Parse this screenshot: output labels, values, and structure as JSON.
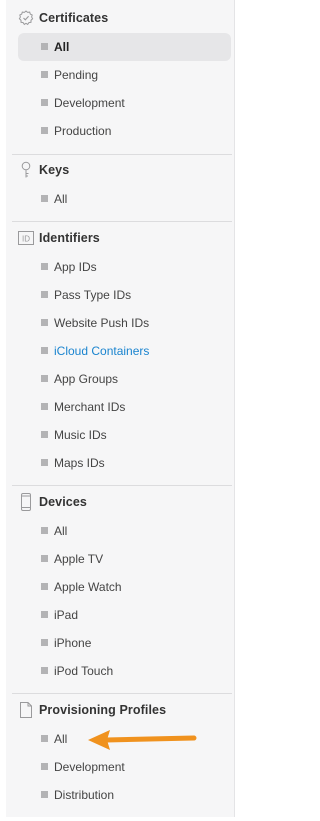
{
  "sections": [
    {
      "title": "Certificates",
      "icon": "certificate-badge-icon",
      "items": [
        {
          "label": "All",
          "active": true
        },
        {
          "label": "Pending"
        },
        {
          "label": "Development"
        },
        {
          "label": "Production"
        }
      ]
    },
    {
      "title": "Keys",
      "icon": "key-icon",
      "items": [
        {
          "label": "All"
        }
      ]
    },
    {
      "title": "Identifiers",
      "icon": "id-badge-icon",
      "icon_text": "ID",
      "items": [
        {
          "label": "App IDs"
        },
        {
          "label": "Pass Type IDs"
        },
        {
          "label": "Website Push IDs"
        },
        {
          "label": "iCloud Containers",
          "link": true
        },
        {
          "label": "App Groups"
        },
        {
          "label": "Merchant IDs"
        },
        {
          "label": "Music IDs"
        },
        {
          "label": "Maps IDs"
        }
      ]
    },
    {
      "title": "Devices",
      "icon": "phone-device-icon",
      "items": [
        {
          "label": "All"
        },
        {
          "label": "Apple TV"
        },
        {
          "label": "Apple Watch"
        },
        {
          "label": "iPad"
        },
        {
          "label": "iPhone"
        },
        {
          "label": "iPod Touch"
        }
      ]
    },
    {
      "title": "Provisioning Profiles",
      "icon": "document-icon",
      "items": [
        {
          "label": "All"
        },
        {
          "label": "Development"
        },
        {
          "label": "Distribution"
        }
      ]
    }
  ],
  "colors": {
    "accent_link": "#1a84cf",
    "annotation_arrow": "#f0921e"
  }
}
